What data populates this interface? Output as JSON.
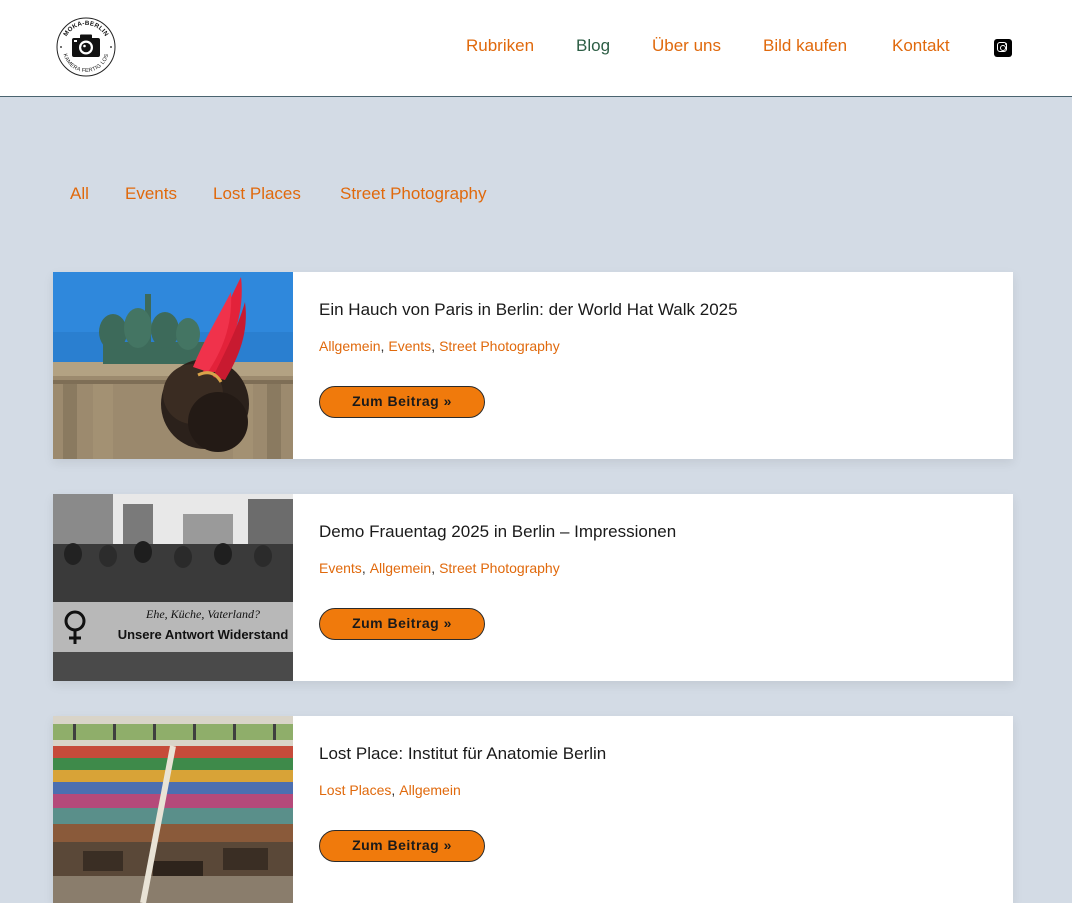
{
  "brand": {
    "logo_top_text": "MOKA-BERLIN",
    "logo_bottom_text": "KAMERA FERTIG LOS"
  },
  "nav": {
    "items": [
      {
        "label": "Rubriken"
      },
      {
        "label": "Blog"
      },
      {
        "label": "Über uns"
      },
      {
        "label": "Bild kaufen"
      },
      {
        "label": "Kontakt"
      }
    ],
    "active_index": 1,
    "social_icon": "instagram-icon"
  },
  "filters": [
    "All",
    "Events",
    "Lost Places",
    "Street Photography"
  ],
  "posts": [
    {
      "title": "Ein Hauch von Paris in Berlin: der World Hat Walk 2025",
      "categories": [
        "Allgemein",
        "Events",
        "Street Photography"
      ],
      "button": "Zum Beitrag »"
    },
    {
      "title": "Demo Frauentag 2025 in Berlin – Impressionen",
      "categories": [
        "Events",
        "Allgemein",
        "Street Photography"
      ],
      "button": "Zum Beitrag »"
    },
    {
      "title": "Lost Place: Institut für Anatomie Berlin",
      "categories": [
        "Lost Places",
        "Allgemein"
      ],
      "button": "Zum Beitrag »"
    }
  ],
  "thumb_texts": {
    "banner_line1": "Ehe, Küche, Vaterland?",
    "banner_line2": "Unsere Antwort Widerstand"
  },
  "colors": {
    "accent": "#e0690c",
    "nav_active": "#2d5e45",
    "button_bg": "#f07a0c",
    "page_bg": "#d3dbe5"
  }
}
